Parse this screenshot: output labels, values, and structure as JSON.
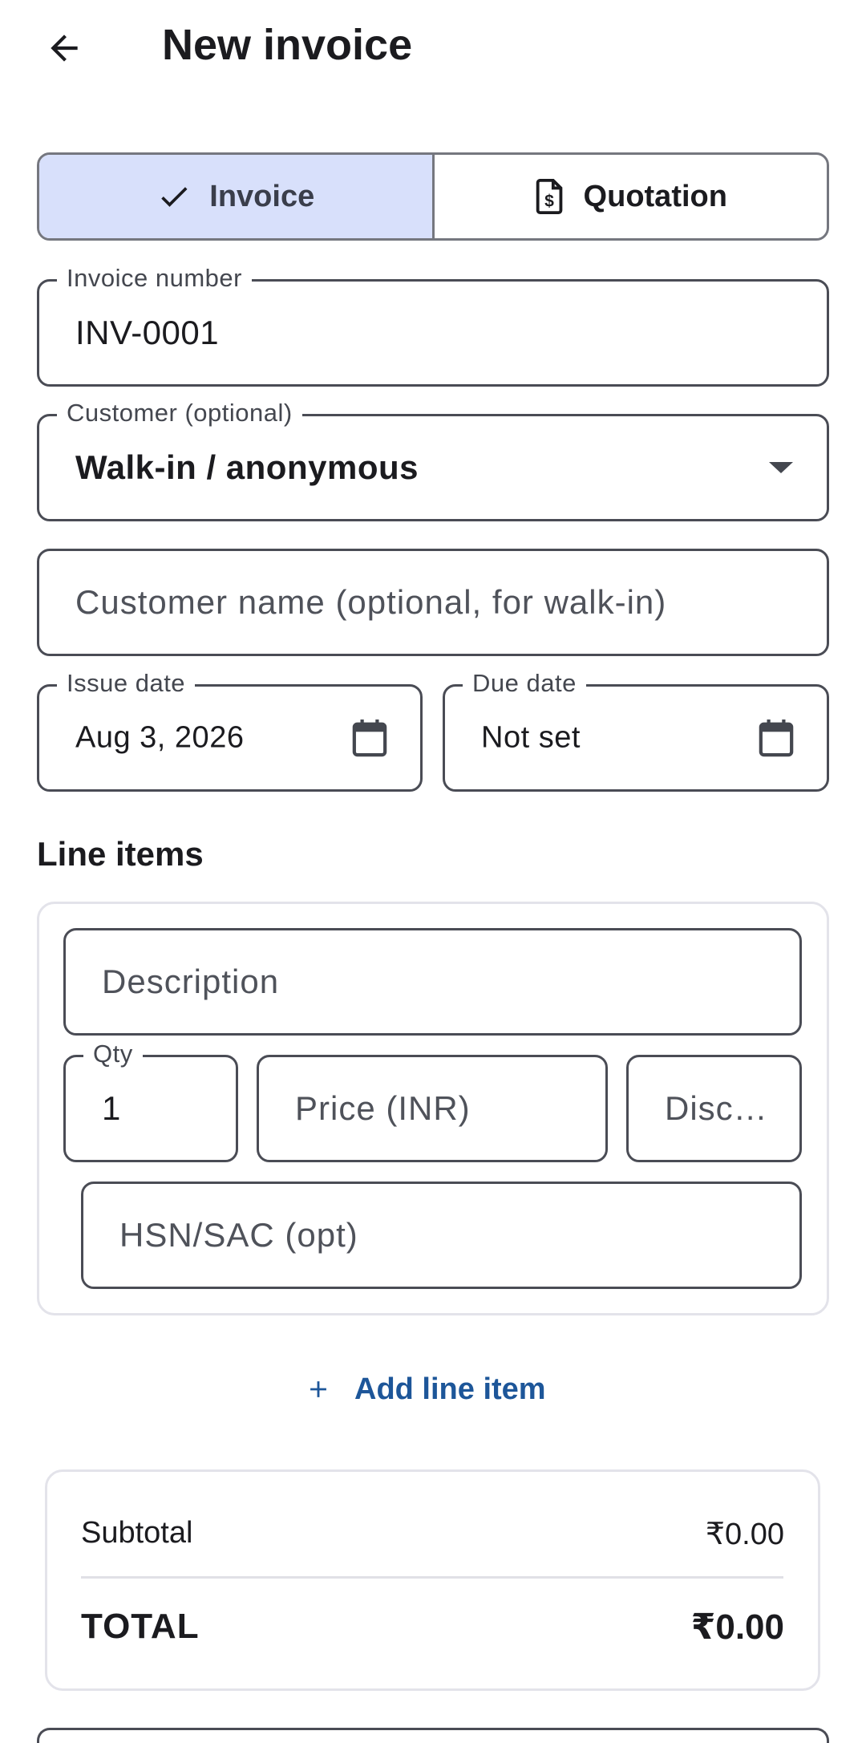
{
  "app_bar": {
    "back_icon": "arrow-back-icon",
    "title": "New invoice"
  },
  "doc_type_toggle": {
    "selected": "invoice",
    "invoice_label": "Invoice",
    "invoice_icon": "check-icon",
    "quotation_label": "Quotation",
    "quotation_icon": "document-dollar-icon"
  },
  "form": {
    "invoice_number": {
      "label": "Invoice number",
      "value": "INV-0001"
    },
    "customer": {
      "label": "Customer (optional)",
      "value": "Walk-in / anonymous",
      "icon": "dropdown-arrow-icon"
    },
    "customer_name": {
      "placeholder": "Customer name (optional, for walk-in)"
    },
    "issue_date": {
      "label": "Issue date",
      "value": "Aug 3, 2026",
      "icon": "calendar-icon"
    },
    "due_date": {
      "label": "Due date",
      "value": "Not set",
      "icon": "calendar-icon"
    }
  },
  "line_items": {
    "section_title": "Line items",
    "items": [
      {
        "description_placeholder": "Description",
        "qty_label": "Qty",
        "qty_value": "1",
        "price_placeholder": "Price (INR)",
        "discount_placeholder": "Disc…",
        "hsn_placeholder": "HSN/SAC (opt)"
      }
    ],
    "add_label": "Add line item",
    "add_icon": "plus-icon"
  },
  "totals": {
    "subtotal_label": "Subtotal",
    "subtotal_value": "₹0.00",
    "total_label": "TOTAL",
    "total_value": "₹0.00"
  },
  "colors": {
    "selected_segment_bg": "#d8e0fb",
    "accent": "#1d5699",
    "outline": "#4a4c55"
  }
}
